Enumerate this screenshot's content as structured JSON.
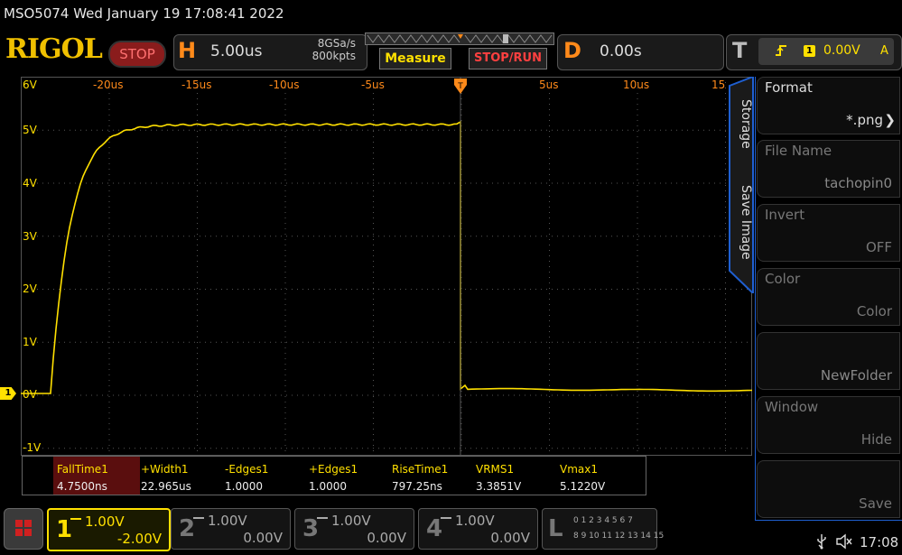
{
  "header": {
    "title": "MSO5074  Wed January 19 17:08:41 2022",
    "brand": "RIGOL",
    "run_state": "STOP",
    "horizontal": {
      "letter": "H",
      "timebase": "5.00us",
      "sample_rate": "8GSa/s",
      "memory_depth": "800kpts"
    },
    "measure_label": "Measure",
    "stop_run_label": "STOP/RUN",
    "delay": {
      "letter": "D",
      "value": "0.00s"
    },
    "trigger": {
      "letter": "T",
      "channel": "1",
      "level": "0.00V",
      "mode": "A"
    }
  },
  "graticule": {
    "y_labels": [
      "6V",
      "5V",
      "4V",
      "3V",
      "2V",
      "1V",
      "0V",
      "-1V"
    ],
    "x_labels": [
      "-20us",
      "-15us",
      "-10us",
      "-5us",
      "5us",
      "10us",
      "15"
    ],
    "channel_marker": "1"
  },
  "side_tabs": {
    "storage": "Storage",
    "save_image": "Save Image"
  },
  "menu": [
    {
      "label": "Format",
      "value": "*.png"
    },
    {
      "label": "File Name",
      "value": "tachopin0"
    },
    {
      "label": "Invert",
      "value": "OFF"
    },
    {
      "label": "Color",
      "value": "Color"
    },
    {
      "label": "",
      "value": "NewFolder"
    },
    {
      "label": "Window",
      "value": "Hide"
    },
    {
      "label": "",
      "value": "Save"
    }
  ],
  "measurements": [
    {
      "name": "FallTime1",
      "value": "4.7500ns"
    },
    {
      "name": "+Width1",
      "value": "22.965us"
    },
    {
      "name": "-Edges1",
      "value": "1.0000"
    },
    {
      "name": "+Edges1",
      "value": "1.0000"
    },
    {
      "name": "RiseTime1",
      "value": "797.25ns"
    },
    {
      "name": "VRMS1",
      "value": "3.3851V"
    },
    {
      "name": "Vmax1",
      "value": "5.1220V"
    }
  ],
  "channels": [
    {
      "num": "1",
      "scale": "1.00V",
      "offset": "-2.00V"
    },
    {
      "num": "2",
      "scale": "1.00V",
      "offset": "0.00V"
    },
    {
      "num": "3",
      "scale": "1.00V",
      "offset": "0.00V"
    },
    {
      "num": "4",
      "scale": "1.00V",
      "offset": "0.00V"
    }
  ],
  "logic": {
    "letter": "L",
    "row1": "0 1 2 3  4 5 6 7",
    "row2": "8 9 10 11 12 13 14 15"
  },
  "status": {
    "clock": "17:08"
  },
  "colors": {
    "ch1": "#ffe000",
    "accent": "#ff8a1a",
    "menu_border": "#1f5fd0"
  }
}
